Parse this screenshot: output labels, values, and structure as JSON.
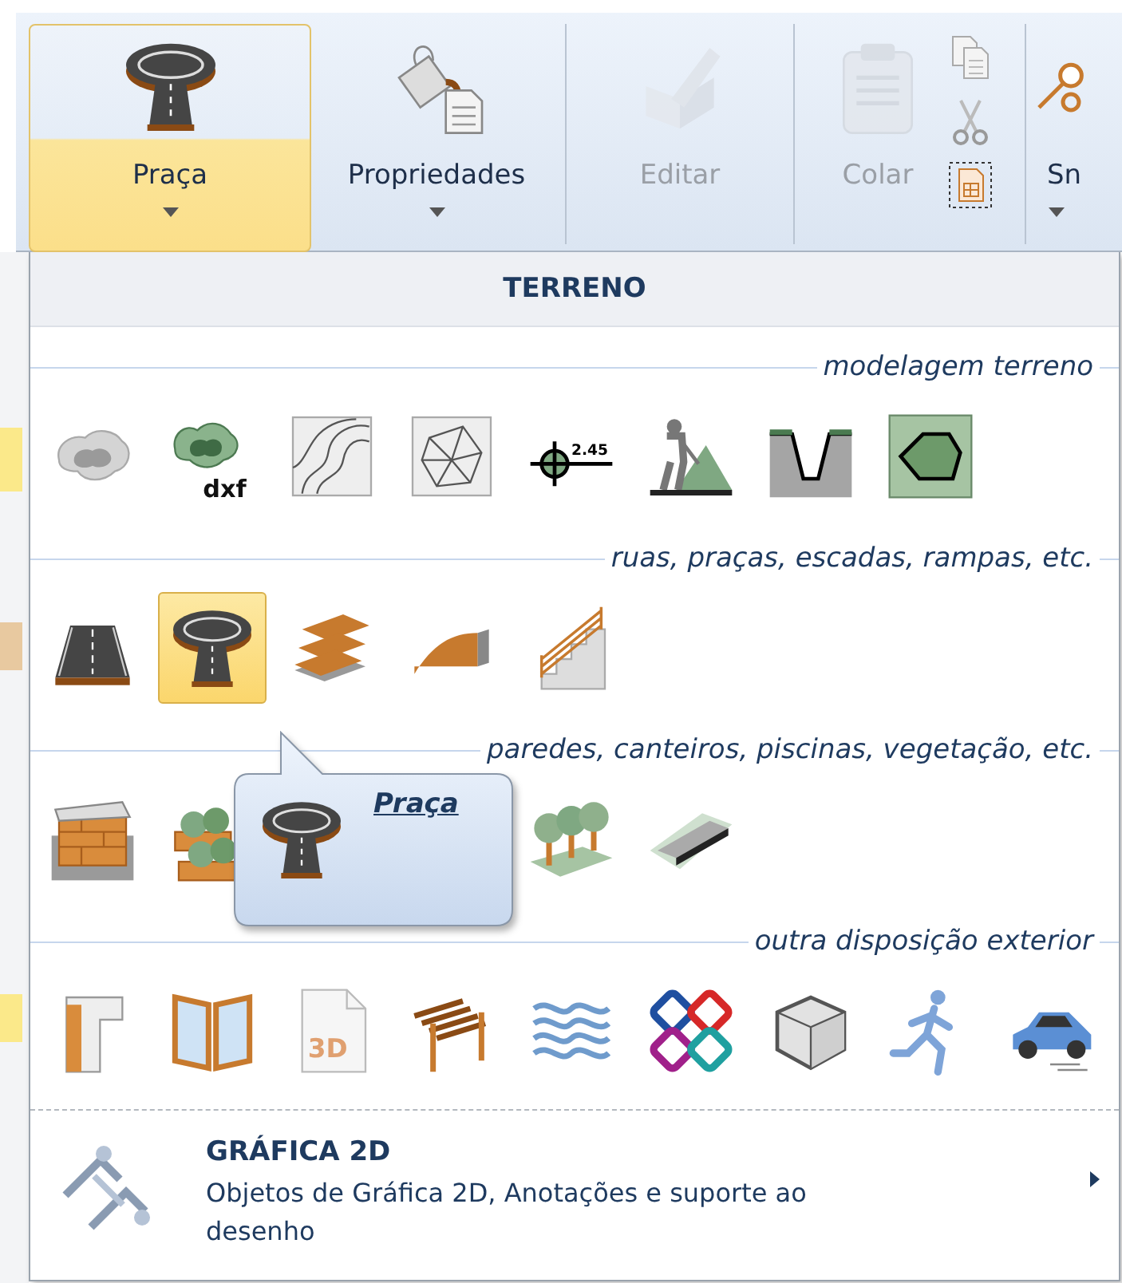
{
  "ribbon": {
    "buttons": [
      {
        "label": "Praça",
        "kind": "plaza",
        "selected": true,
        "disabled": false,
        "caret": true
      },
      {
        "label": "Propriedades",
        "kind": "properties",
        "selected": false,
        "disabled": false,
        "caret": true
      },
      {
        "label": "Editar",
        "kind": "edit",
        "selected": false,
        "disabled": true,
        "caret": false
      },
      {
        "label": "Colar",
        "kind": "paste",
        "selected": false,
        "disabled": true,
        "caret": false
      },
      {
        "label": "Sn",
        "kind": "search",
        "selected": false,
        "disabled": false,
        "caret": true
      }
    ]
  },
  "menu": {
    "header": "TERRENO",
    "sections": [
      {
        "title": "modelagem terreno",
        "tools": [
          {
            "kind": "terrain",
            "selected": false
          },
          {
            "kind": "dxf-terrain",
            "badge": "dxf",
            "selected": false
          },
          {
            "kind": "contours",
            "selected": false
          },
          {
            "kind": "mesh",
            "selected": false
          },
          {
            "kind": "benchmark",
            "badge": "2.45",
            "selected": false
          },
          {
            "kind": "digger",
            "selected": false
          },
          {
            "kind": "trench",
            "selected": false
          },
          {
            "kind": "polygon",
            "selected": false
          }
        ]
      },
      {
        "title": "ruas, praças, escadas, rampas, etc.",
        "tools": [
          {
            "kind": "road",
            "selected": false
          },
          {
            "kind": "plaza",
            "selected": true
          },
          {
            "kind": "steps",
            "selected": false
          },
          {
            "kind": "ramp",
            "selected": false
          },
          {
            "kind": "staircase",
            "selected": false
          }
        ]
      },
      {
        "title": "paredes, canteiros, piscinas, vegetação, etc.",
        "tools": [
          {
            "kind": "wall",
            "selected": false
          },
          {
            "kind": "planter",
            "selected": false
          },
          {
            "kind": "trees",
            "selected": false
          },
          {
            "kind": "curb",
            "selected": false
          }
        ]
      },
      {
        "title": "outra disposição exterior",
        "tools": [
          {
            "kind": "profile",
            "selected": false
          },
          {
            "kind": "panels",
            "selected": false
          },
          {
            "kind": "file3d",
            "badge": "3D",
            "selected": false
          },
          {
            "kind": "pergola",
            "selected": false
          },
          {
            "kind": "waves",
            "selected": false
          },
          {
            "kind": "chain",
            "selected": false
          },
          {
            "kind": "box",
            "selected": false
          },
          {
            "kind": "runner",
            "selected": false
          },
          {
            "kind": "car",
            "selected": false
          }
        ]
      }
    ],
    "tooltip": {
      "title": "Praça"
    },
    "submenu": {
      "title": "GRÁFICA 2D",
      "description": "Objetos de Gráfica 2D, Anotações e suporte ao desenho"
    }
  }
}
